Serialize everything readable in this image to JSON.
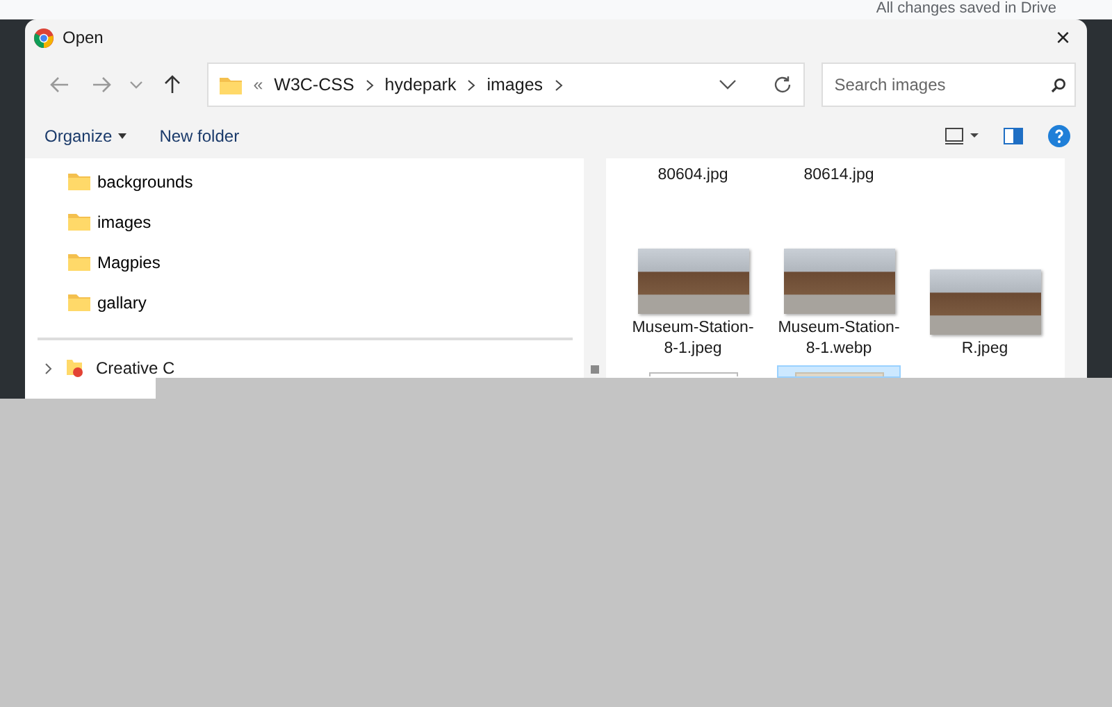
{
  "background_status": "All changes saved in Drive",
  "window": {
    "title": "Open",
    "close": "×"
  },
  "address": {
    "overflow": "«",
    "path": [
      "W3C-CSS",
      "hydepark",
      "images"
    ]
  },
  "search": {
    "placeholder": "Search images"
  },
  "toolbar": {
    "organize": "Organize",
    "new_folder": "New folder"
  },
  "folders": [
    {
      "name": "backgrounds"
    },
    {
      "name": "images"
    },
    {
      "name": "Magpies"
    },
    {
      "name": "gallary"
    }
  ],
  "nav_items": [
    {
      "name": "Creative C",
      "expanded": false
    }
  ],
  "files": [
    {
      "kind": "label",
      "name": "80604.jpg",
      "selected": false
    },
    {
      "kind": "label",
      "name": "80614.jpg",
      "selected": false
    },
    {
      "kind": "photo",
      "name": "Museum-Station-8-1.jpeg",
      "selected": false
    },
    {
      "kind": "photo",
      "name": "Museum-Station-8-1.webp",
      "selected": false
    },
    {
      "kind": "photo",
      "name": "R.jpeg",
      "selected": false
    },
    {
      "kind": "partial",
      "selected": false
    },
    {
      "kind": "partial",
      "selected": true
    }
  ]
}
